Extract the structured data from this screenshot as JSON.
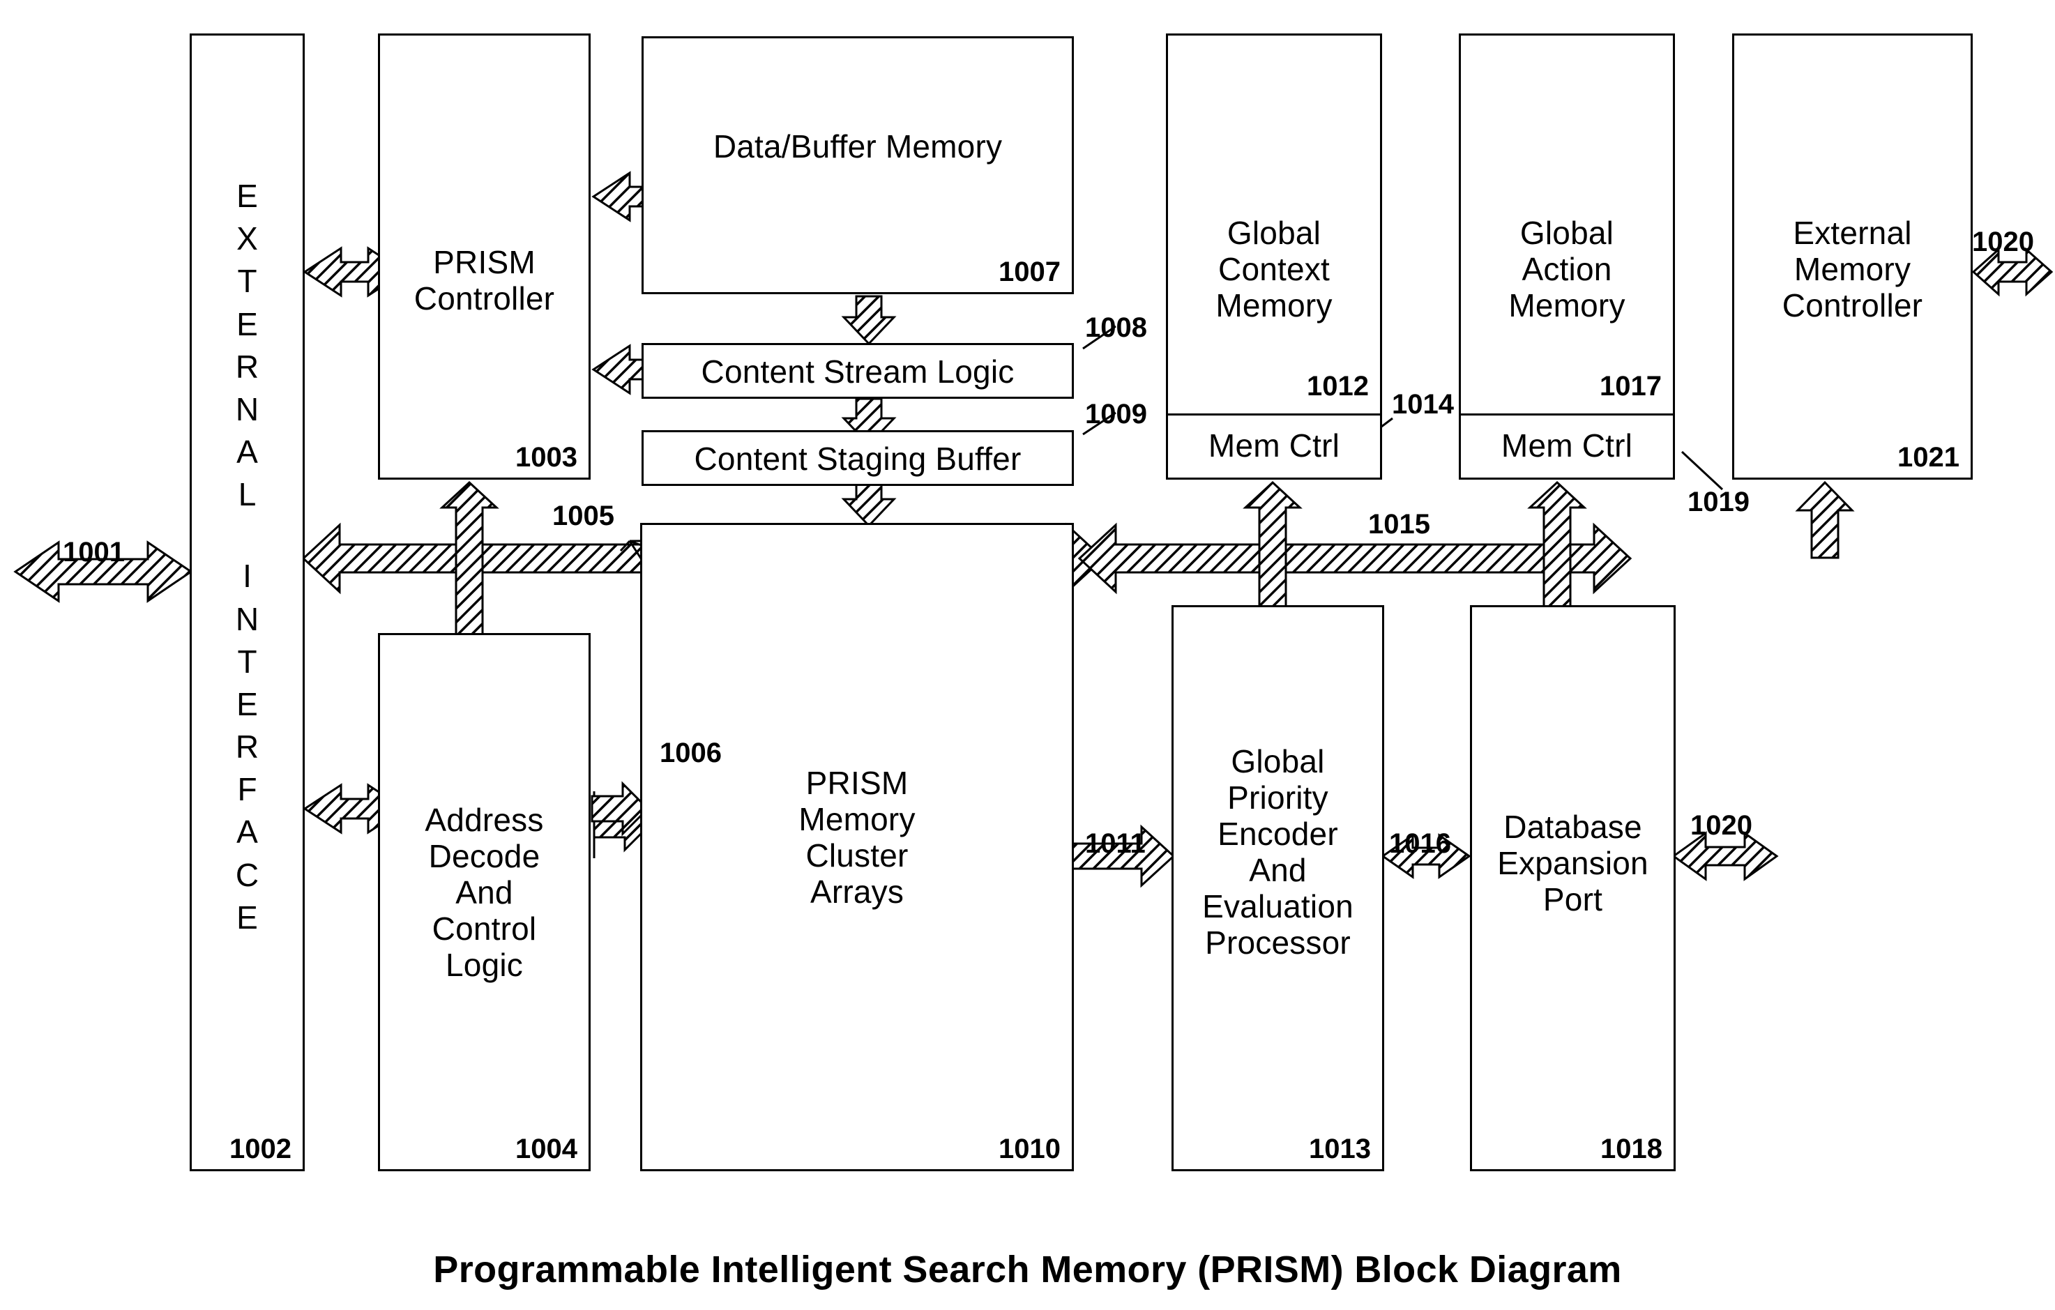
{
  "caption": "Programmable Intelligent Search Memory (PRISM) Block Diagram",
  "blocks": {
    "external_interface": {
      "label": "EXTERNAL INTERFACE",
      "letters": [
        "E",
        "X",
        "T",
        "E",
        "R",
        "N",
        "A",
        "L",
        "",
        "I",
        "N",
        "T",
        "E",
        "R",
        "F",
        "A",
        "C",
        "E"
      ],
      "ref": "1002"
    },
    "prism_controller": {
      "label": "PRISM\nController",
      "line1": "PRISM",
      "line2": "Controller",
      "ref": "1003"
    },
    "data_buffer_memory": {
      "label": "Data/Buffer Memory",
      "ref": "1007"
    },
    "content_stream_logic": {
      "label": "Content Stream Logic",
      "ref": "1008"
    },
    "content_staging_buffer": {
      "label": "Content Staging Buffer",
      "ref": "1009"
    },
    "global_context_memory": {
      "line1": "Global",
      "line2": "Context",
      "line3": "Memory",
      "ref": "1012",
      "memctrl_label": "Mem Ctrl",
      "memctrl_ref": "1014"
    },
    "global_action_memory": {
      "line1": "Global",
      "line2": "Action",
      "line3": "Memory",
      "ref": "1017",
      "memctrl_label": "Mem Ctrl",
      "memctrl_ref": "1019"
    },
    "external_memory_controller": {
      "line1": "External",
      "line2": "Memory",
      "line3": "Controller",
      "ref": "1021"
    },
    "address_decode": {
      "line1": "Address",
      "line2": "Decode",
      "line3": "And",
      "line4": "Control",
      "line5": "Logic",
      "ref": "1004"
    },
    "prism_memory_cluster": {
      "line1": "PRISM",
      "line2": "Memory",
      "line3": "Cluster",
      "line4": "Arrays",
      "ref": "1010",
      "grid_cols": 5,
      "grid_rows": 7
    },
    "global_priority_encoder": {
      "line1": "Global",
      "line2": "Priority",
      "line3": "Encoder",
      "line4": "And",
      "line5": "Evaluation",
      "line6": "Processor",
      "ref": "1013"
    },
    "database_expansion_port": {
      "line1": "Database",
      "line2": "Expansion",
      "line3": "Port",
      "ref": "1018"
    }
  },
  "connectors": {
    "external_bus_left": "1001",
    "prism_internal_bus": "1005",
    "addr_to_cluster": "1006",
    "cluster_to_encoder": "1011",
    "global_bus_right": "1015",
    "encoder_to_dbport": "1016",
    "ext_mem_ctrl_right": "1020",
    "db_port_right": "1020"
  },
  "colors": {
    "ink": "#000000",
    "paper": "#ffffff"
  }
}
